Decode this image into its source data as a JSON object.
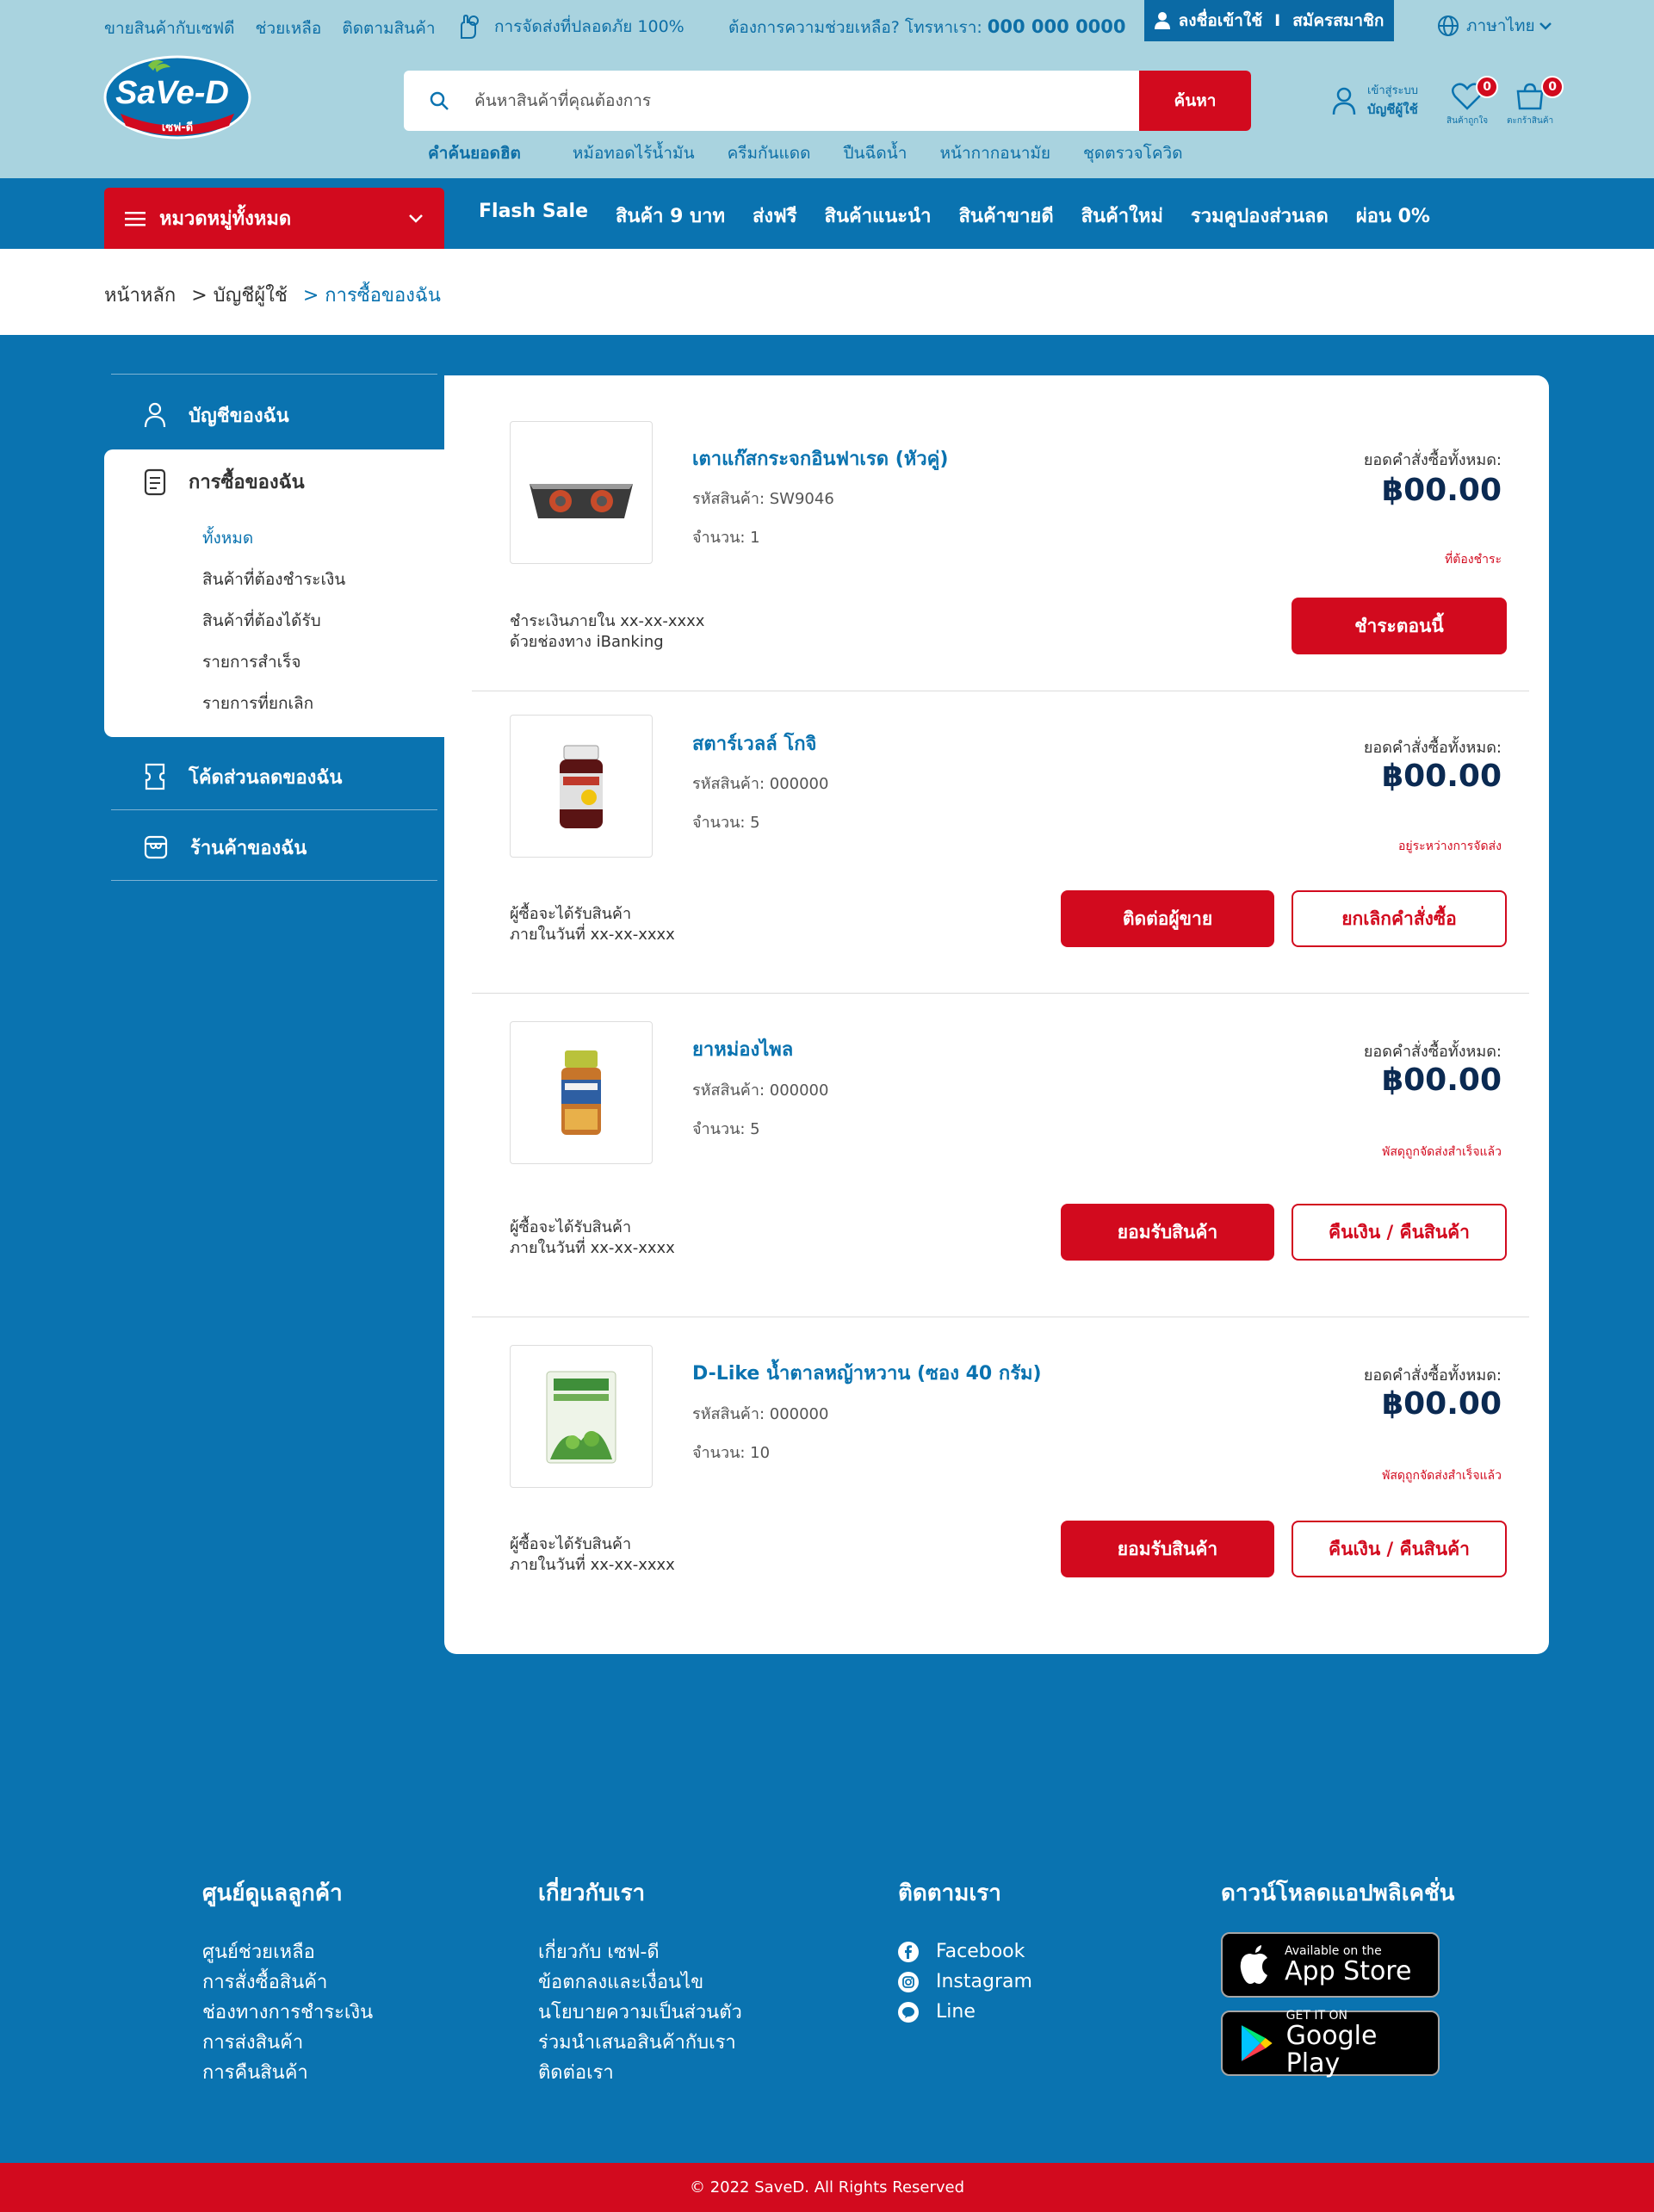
{
  "topbar": {
    "links": [
      "ขายสินค้ากับเซฟดี",
      "ช่วยเหลือ",
      "ติดตามสินค้า"
    ],
    "safe_shipping": "การจัดส่งที่ปลอดภัย 100%",
    "hotline_label": "ต้องการความช่วยเหลือ? โทรหาเรา:",
    "hotline_number": "000 000 0000",
    "login": "ลงชื่อเข้าใช้",
    "signup": "สมัครสมาชิก",
    "separator": "I",
    "language": "ภาษาไทย"
  },
  "logo": {
    "text": "SaVe-D",
    "sub": "เซฟ-ดี"
  },
  "search": {
    "placeholder": "ค้นหาสินค้าที่คุณต้องการ",
    "button": "ค้นหา",
    "hot_title": "คำค้นยอดฮิต",
    "hot_terms": [
      "หม้อทอดไร้น้ำมัน",
      "ครีมกันแดด",
      "ปืนฉีดน้ำ",
      "หน้ากากอนามัย",
      "ชุดตรวจโควิด"
    ]
  },
  "header_actions": {
    "account_line1": "เข้าสู่ระบบ",
    "account_line2": "บัญชีผู้ใช้",
    "wishlist_label": "สินค้าถูกใจ",
    "wishlist_count": "0",
    "cart_label": "ตะกร้าสินค้า",
    "cart_count": "0"
  },
  "nav": {
    "category_button": "หมวดหมู่ทั้งหมด",
    "items": [
      "Flash Sale",
      "สินค้า 9 บาท",
      "ส่งฟรี",
      "สินค้าแนะนำ",
      "สินค้าขายดี",
      "สินค้าใหม่",
      "รวมคูปองส่วนลด",
      "ผ่อน 0%"
    ]
  },
  "breadcrumb": [
    "หน้าหลัก",
    "> บัญชีผู้ใช้",
    "> การซื้อของฉัน"
  ],
  "sidebar": {
    "account": "บัญชีของฉัน",
    "purchases": "การซื้อของฉัน",
    "sub_items": [
      "ทั้งหมด",
      "สินค้าที่ต้องชำระเงิน",
      "สินค้าที่ต้องได้รับ",
      "รายการสำเร็จ",
      "รายการที่ยกเลิก"
    ],
    "coupons": "โค้ดส่วนลดของฉัน",
    "shop": "ร้านค้าของฉัน"
  },
  "orders": [
    {
      "name": "เตาแก๊สกระจกอินฟาเรด (หัวคู่)",
      "sku": "รหัสสินค้า: SW9046",
      "qty": "จำนวน: 1",
      "total_label": "ยอดคำสั่งซื้อทั้งหมด:",
      "total": "฿00.00",
      "status": "ที่ต้องชำระ",
      "note1": "ชำระเงินภายใน xx-xx-xxxx",
      "note2": "ด้วยช่องทาง iBanking",
      "primary": "ชำระตอนนี้",
      "secondary": ""
    },
    {
      "name": "สตาร์เวลล์ โกจิ",
      "sku": "รหัสสินค้า: 000000",
      "qty": "จำนวน: 5",
      "total_label": "ยอดคำสั่งซื้อทั้งหมด:",
      "total": "฿00.00",
      "status": "อยู่ระหว่างการจัดส่ง",
      "note1": "ผู้ซื้อจะได้รับสินค้า",
      "note2": "ภายในวันที่ xx-xx-xxxx",
      "primary": "ติดต่อผู้ขาย",
      "secondary": "ยกเลิกคำสั่งซื้อ"
    },
    {
      "name": "ยาหม่องไพล",
      "sku": "รหัสสินค้า: 000000",
      "qty": "จำนวน: 5",
      "total_label": "ยอดคำสั่งซื้อทั้งหมด:",
      "total": "฿00.00",
      "status": "พัสดุถูกจัดส่งสำเร็จแล้ว",
      "note1": "ผู้ซื้อจะได้รับสินค้า",
      "note2": "ภายในวันที่ xx-xx-xxxx",
      "primary": "ยอมรับสินค้า",
      "secondary": "คืนเงิน / คืนสินค้า"
    },
    {
      "name": "D-Like น้ำตาลหญ้าหวาน (ซอง 40 กรัม)",
      "sku": "รหัสสินค้า: 000000",
      "qty": "จำนวน: 10",
      "total_label": "ยอดคำสั่งซื้อทั้งหมด:",
      "total": "฿00.00",
      "status": "พัสดุถูกจัดส่งสำเร็จแล้ว",
      "note1": "ผู้ซื้อจะได้รับสินค้า",
      "note2": "ภายในวันที่ xx-xx-xxxx",
      "primary": "ยอมรับสินค้า",
      "secondary": "คืนเงิน / คืนสินค้า"
    }
  ],
  "footer": {
    "support_title": "ศูนย์ดูแลลูกค้า",
    "support_links": [
      "ศูนย์ช่วยเหลือ",
      "การสั่งซื้อสินค้า",
      "ช่องทางการชำระเงิน",
      "การส่งสินค้า",
      "การคืนสินค้า"
    ],
    "about_title": "เกี่ยวกับเรา",
    "about_links": [
      "เกี่ยวกับ เซฟ-ดี",
      "ข้อตกลงและเงื่อนไข",
      "นโยบายความเป็นส่วนตัว",
      "ร่วมนำเสนอสินค้ากับเรา",
      "ติดต่อเรา"
    ],
    "follow_title": "ติดตามเรา",
    "follow_links": [
      "Facebook",
      "Instagram",
      "Line"
    ],
    "app_title": "ดาวน์โหลดแอปพลิเคชั่น",
    "appstore_small": "Available on the",
    "appstore_large": "App Store",
    "gplay_small": "GET IT ON",
    "gplay_large": "Google Play",
    "copyright": "© 2022 SaveD. All Rights Reserved"
  },
  "colors": {
    "header_bg": "#a9d3df",
    "primary_blue": "#0a73b0",
    "accent_red": "#d20a1e"
  }
}
